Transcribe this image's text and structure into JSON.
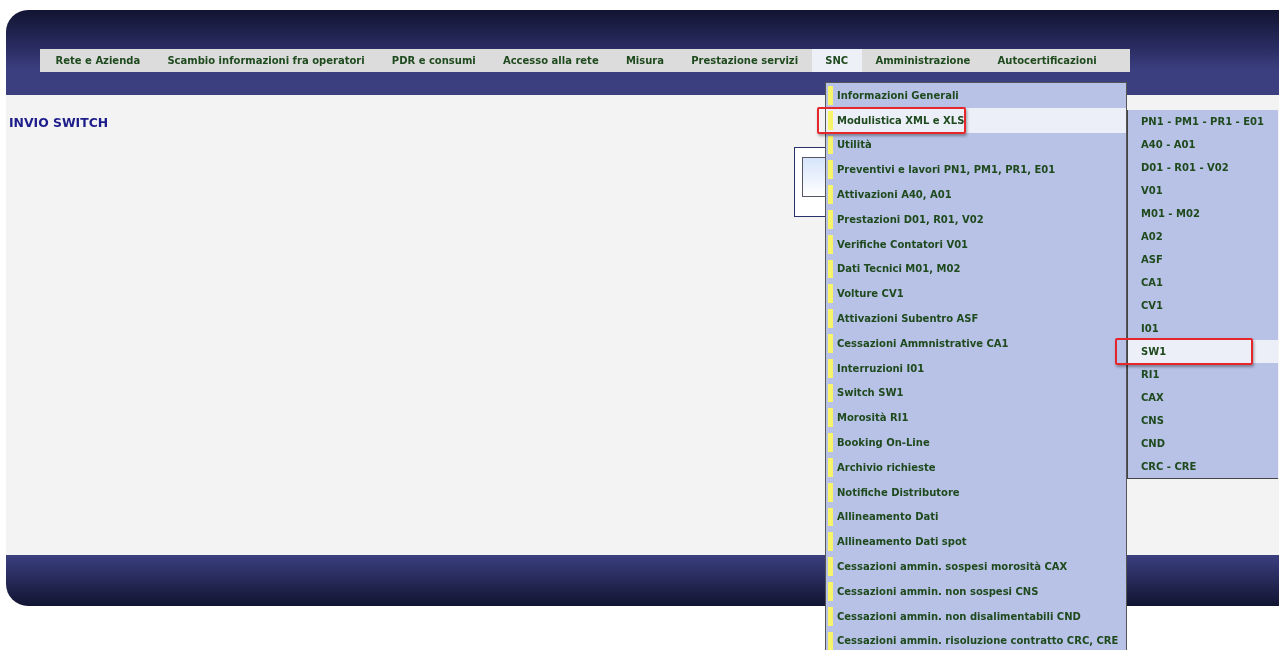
{
  "nav": {
    "items": [
      {
        "label": "Rete e Azienda",
        "selected": false
      },
      {
        "label": "Scambio informazioni fra operatori",
        "selected": false
      },
      {
        "label": "PDR e consumi",
        "selected": false
      },
      {
        "label": "Accesso alla rete",
        "selected": false
      },
      {
        "label": "Misura",
        "selected": false
      },
      {
        "label": "Prestazione servizi",
        "selected": false
      },
      {
        "label": "SNC",
        "selected": true
      },
      {
        "label": "Amministrazione",
        "selected": false
      },
      {
        "label": "Autocertificazioni",
        "selected": false
      }
    ]
  },
  "page_title": "INVIO SWITCH",
  "dropdown": {
    "items": [
      {
        "label": "Informazioni Generali",
        "selected": false
      },
      {
        "label": "Modulistica XML e XLS",
        "selected": true
      },
      {
        "label": "Utilità",
        "selected": false
      },
      {
        "label": "Preventivi e lavori PN1, PM1, PR1, E01",
        "selected": false
      },
      {
        "label": "Attivazioni A40, A01",
        "selected": false
      },
      {
        "label": "Prestazioni D01, R01, V02",
        "selected": false
      },
      {
        "label": "Verifiche Contatori V01",
        "selected": false
      },
      {
        "label": "Dati Tecnici M01, M02",
        "selected": false
      },
      {
        "label": "Volture CV1",
        "selected": false
      },
      {
        "label": "Attivazioni Subentro ASF",
        "selected": false
      },
      {
        "label": "Cessazioni Ammnistrative CA1",
        "selected": false
      },
      {
        "label": "Interruzioni I01",
        "selected": false
      },
      {
        "label": "Switch SW1",
        "selected": false
      },
      {
        "label": "Morosità RI1",
        "selected": false
      },
      {
        "label": "Booking On-Line",
        "selected": false
      },
      {
        "label": "Archivio richieste",
        "selected": false
      },
      {
        "label": "Notifiche Distributore",
        "selected": false
      },
      {
        "label": "Allineamento Dati",
        "selected": false
      },
      {
        "label": "Allineamento Dati spot",
        "selected": false
      },
      {
        "label": "Cessazioni ammin. sospesi morosità CAX",
        "selected": false
      },
      {
        "label": "Cessazioni ammin. non sospesi CNS",
        "selected": false
      },
      {
        "label": "Cessazioni ammin. non disalimentabili CND",
        "selected": false
      },
      {
        "label": "Cessazioni ammin. risoluzione contratto CRC, CRE",
        "selected": false
      }
    ]
  },
  "submenu": {
    "items": [
      {
        "label": "PN1 - PM1 - PR1 - E01",
        "selected": false
      },
      {
        "label": "A40 - A01",
        "selected": false
      },
      {
        "label": "D01 - R01 - V02",
        "selected": false
      },
      {
        "label": "V01",
        "selected": false
      },
      {
        "label": "M01 - M02",
        "selected": false
      },
      {
        "label": "A02",
        "selected": false
      },
      {
        "label": "ASF",
        "selected": false
      },
      {
        "label": "CA1",
        "selected": false
      },
      {
        "label": "CV1",
        "selected": false
      },
      {
        "label": "I01",
        "selected": false
      },
      {
        "label": "SW1",
        "selected": true
      },
      {
        "label": "RI1",
        "selected": false
      },
      {
        "label": "CAX",
        "selected": false
      },
      {
        "label": "CNS",
        "selected": false
      },
      {
        "label": "CND",
        "selected": false
      },
      {
        "label": "CRC - CRE",
        "selected": false
      }
    ]
  }
}
